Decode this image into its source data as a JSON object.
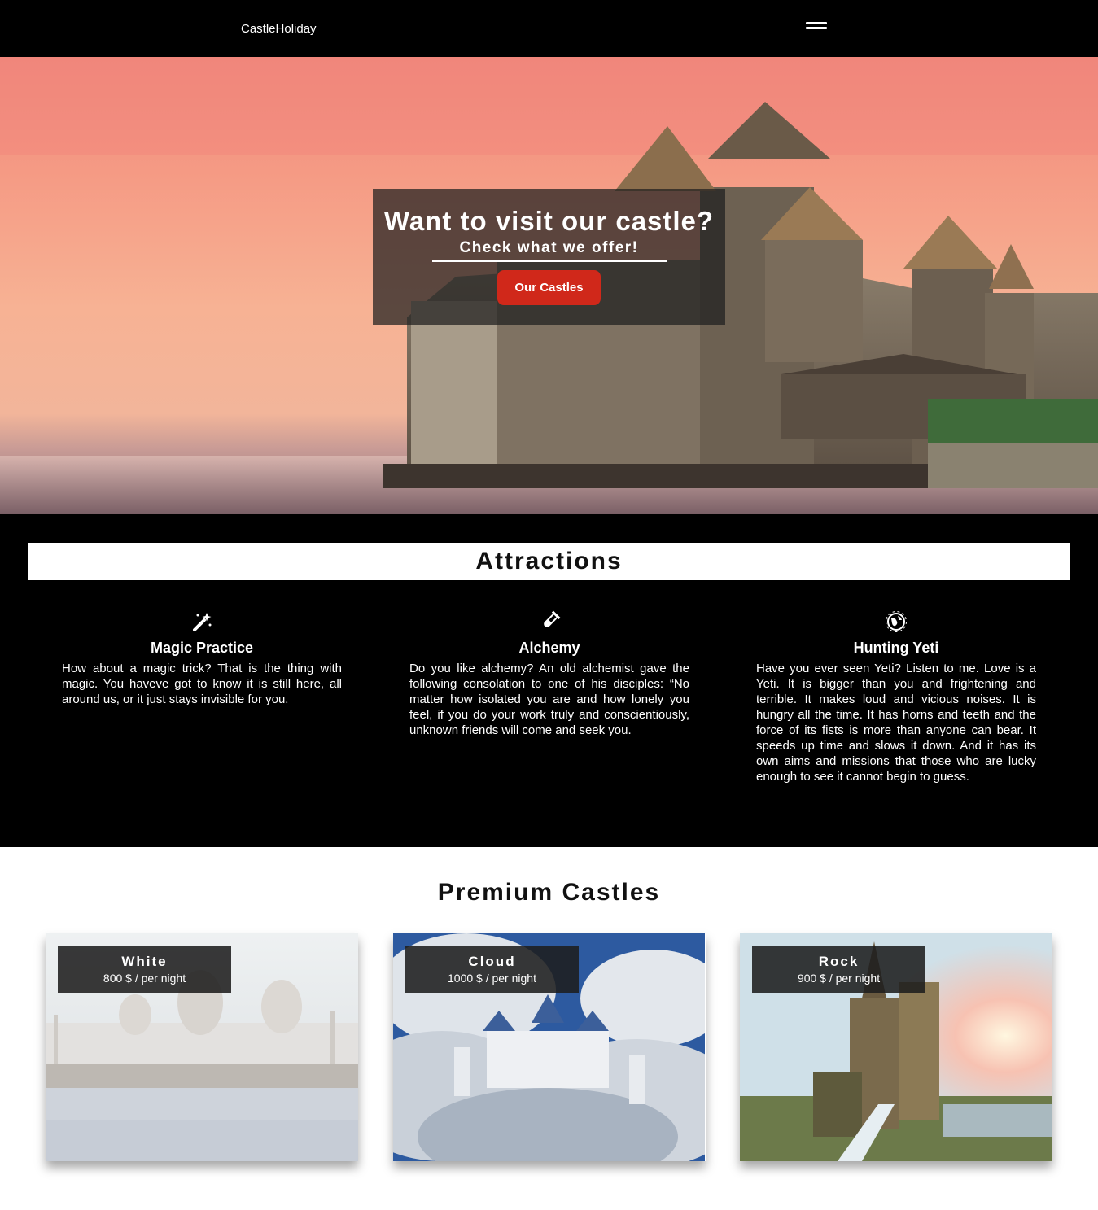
{
  "nav": {
    "brand": "CastleHoliday",
    "menu_icon": "hamburger-menu-icon"
  },
  "hero": {
    "title": "Want to visit our castle?",
    "subtitle": "Check what we offer!",
    "button_label": "Our Castles",
    "accent_color": "#d0281a"
  },
  "attractions": {
    "heading": "Attractions",
    "items": [
      {
        "icon": "magic-wand-icon",
        "title": "Magic Practice",
        "text": "How about a magic trick? That is the thing with magic. You haveve got to know it is still here, all around us, or it just stays invisible for you."
      },
      {
        "icon": "test-tube-icon",
        "title": "Alchemy",
        "text": "Do you like alchemy? An old alchemist gave the following consolation to one of his disciples: “No matter how isolated you are and how lonely you feel, if you do your work truly and conscientiously, unknown friends will come and seek you."
      },
      {
        "icon": "globe-icon",
        "title": "Hunting Yeti",
        "text": "Have you ever seen Yeti? Listen to me. Love is a Yeti. It is bigger than you and frightening and terrible. It makes loud and vicious noises. It is hungry all the time. It has horns and teeth and the force of its fists is more than anyone can bear. It speeds up time and slows it down. And it has its own aims and missions that those who are lucky enough to see it cannot begin to guess."
      }
    ]
  },
  "premium": {
    "heading": "Premium Castles",
    "castles": [
      {
        "name": "White",
        "price": "800 $ / per night"
      },
      {
        "name": "Cloud",
        "price": "1000 $ / per night"
      },
      {
        "name": "Rock",
        "price": "900 $ / per night"
      }
    ]
  }
}
